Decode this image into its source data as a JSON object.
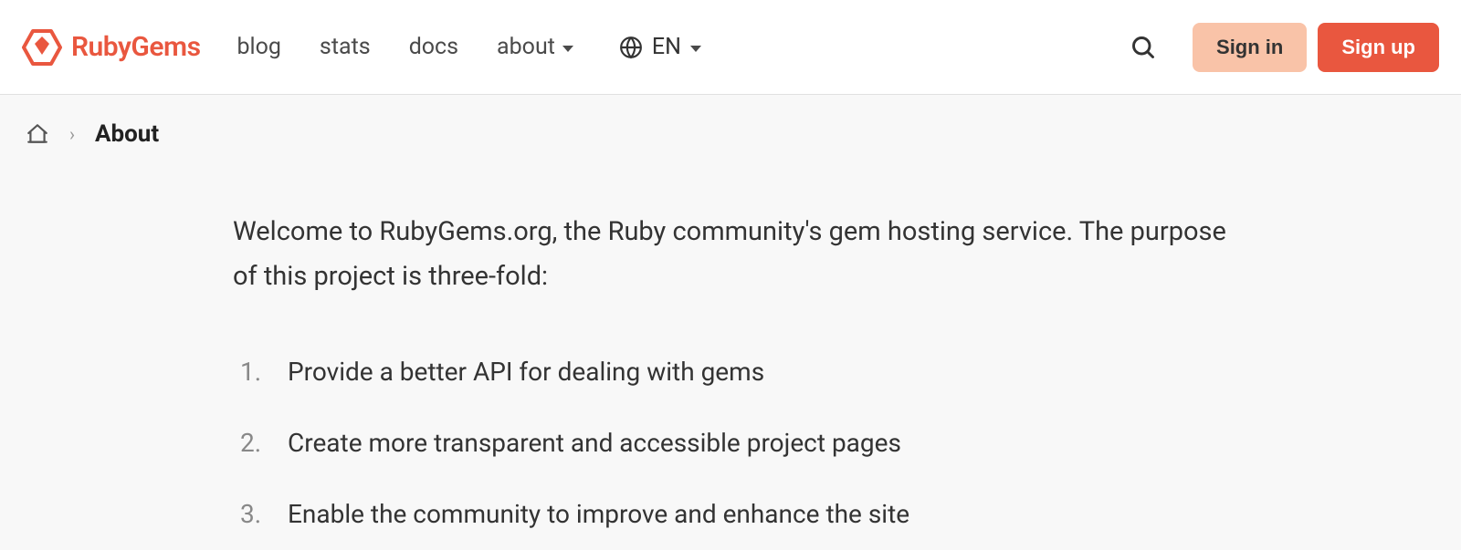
{
  "brand": "RubyGems",
  "nav": {
    "blog": "blog",
    "stats": "stats",
    "docs": "docs",
    "about": "about"
  },
  "lang": "EN",
  "auth": {
    "signin": "Sign in",
    "signup": "Sign up"
  },
  "breadcrumb": {
    "current": "About"
  },
  "content": {
    "intro": "Welcome to RubyGems.org, the Ruby community's gem hosting service. The purpose of this project is three-fold:",
    "items": [
      "Provide a better API for dealing with gems",
      "Create more transparent and accessible project pages",
      "Enable the community to improve and enhance the site"
    ]
  }
}
